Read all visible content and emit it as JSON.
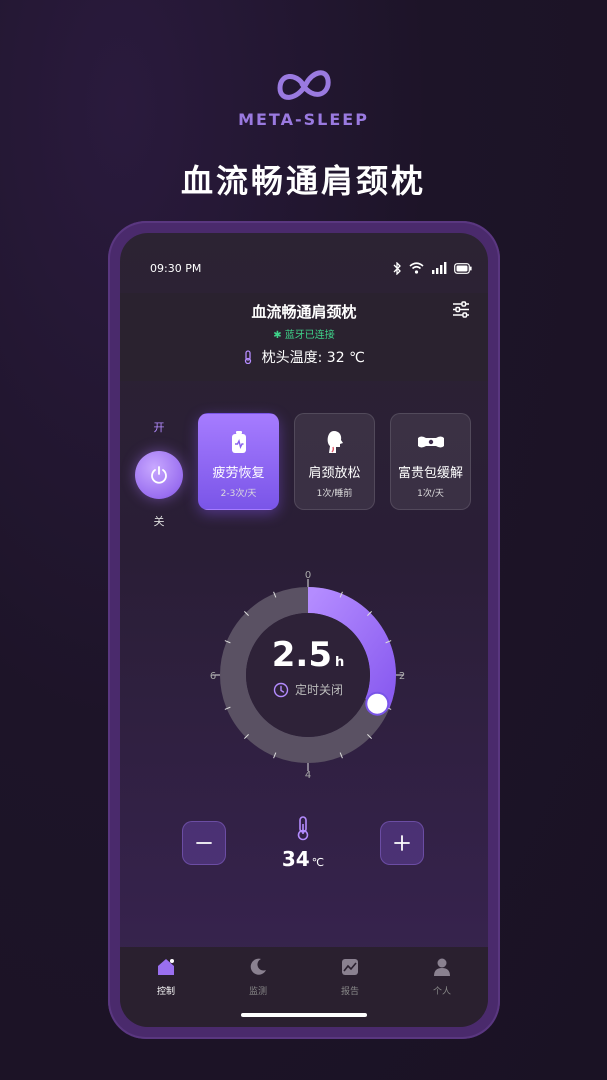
{
  "brand": {
    "name": "META-SLEEP",
    "tagline": "血流畅通肩颈枕"
  },
  "status_bar": {
    "time": "09:30 PM"
  },
  "header": {
    "title": "血流畅通肩颈枕",
    "bluetooth_status": "蓝牙已连接",
    "pillow_temp": "枕头温度: 32 ℃"
  },
  "power": {
    "on_label": "开",
    "off_label": "关"
  },
  "modes": [
    {
      "name": "疲劳恢复",
      "freq": "2-3次/天",
      "active": true
    },
    {
      "name": "肩颈放松",
      "freq": "1次/睡前",
      "active": false
    },
    {
      "name": "富贵包缓解",
      "freq": "1次/天",
      "active": false
    }
  ],
  "timer": {
    "value": "2.5",
    "unit": "h",
    "label": "定时关闭",
    "ticks": [
      "0",
      "2",
      "4",
      "6"
    ],
    "progress_hours": 2.5,
    "max_hours": 8
  },
  "temperature": {
    "value": "34",
    "unit": "℃"
  },
  "tabs": [
    {
      "label": "控制",
      "icon": "home-icon",
      "active": true
    },
    {
      "label": "监测",
      "icon": "moon-icon",
      "active": false
    },
    {
      "label": "报告",
      "icon": "chart-icon",
      "active": false
    },
    {
      "label": "个人",
      "icon": "user-icon",
      "active": false
    }
  ],
  "colors": {
    "accent": "#9a6ff0",
    "connected": "#3fd38a",
    "background": "#1d1428"
  }
}
